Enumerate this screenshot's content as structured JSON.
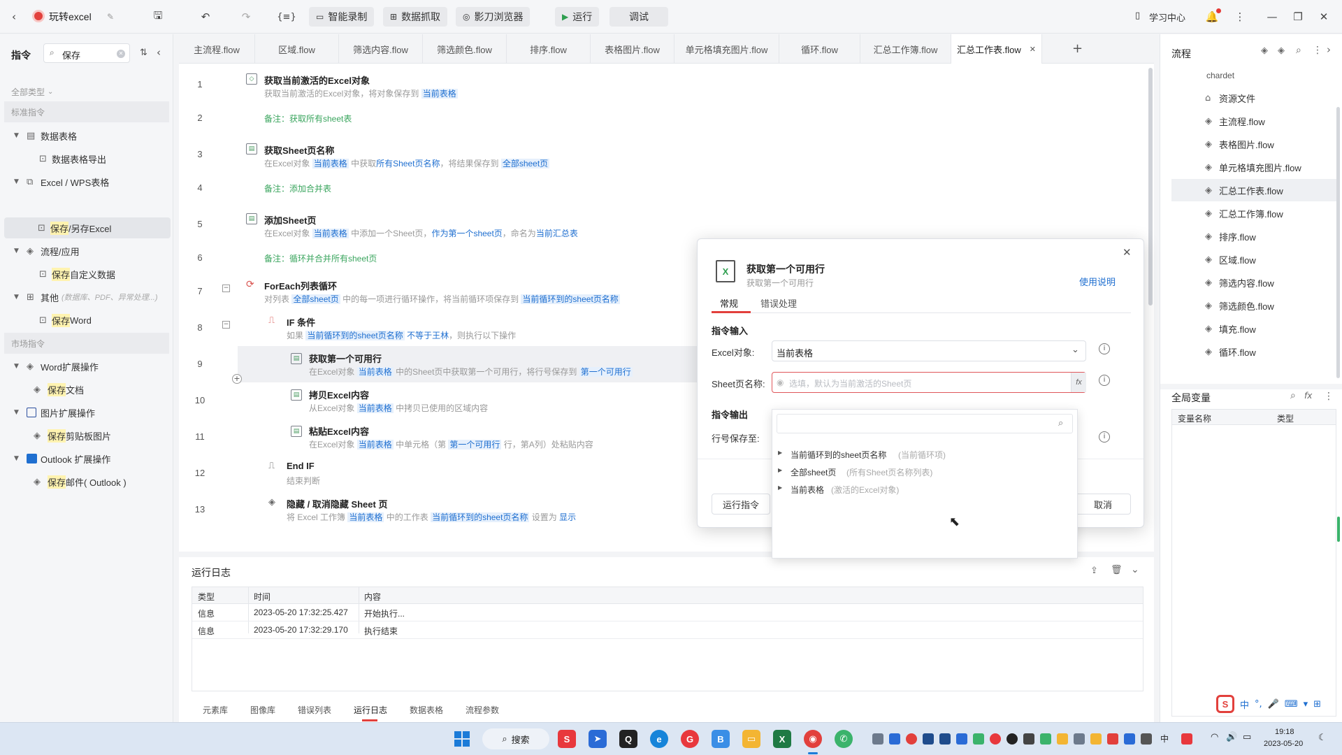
{
  "titlebar": {
    "app_name": "玩转excel",
    "buttons": {
      "smart_record": "智能录制",
      "data_capture": "数据抓取",
      "shadow_browser": "影刀浏览器",
      "run": "运行",
      "debug": "调试"
    },
    "learning_center": "学习中心"
  },
  "left": {
    "tab_title": "指令",
    "search_value": "保存",
    "all_types": "全部类型",
    "std_header": "标准指令",
    "groups": [
      {
        "label": "数据表格",
        "items": [
          {
            "label": "数据表格导出"
          }
        ]
      },
      {
        "label": "Excel / WPS表格",
        "items": [
          {
            "hl": "保存",
            "rest": "/另存Excel"
          }
        ]
      },
      {
        "label": "流程/应用",
        "items": [
          {
            "hl": "保存",
            "rest": "自定义数据"
          }
        ]
      },
      {
        "label": "其他",
        "note": "(数据库、PDF、异常处理...)",
        "items": [
          {
            "hl": "保存",
            "rest": "Word"
          }
        ]
      }
    ],
    "market_header": "市场指令",
    "market_groups": [
      {
        "label": "Word扩展操作",
        "items": [
          {
            "hl": "保存",
            "rest": "文档"
          }
        ]
      },
      {
        "label": "图片扩展操作",
        "items": [
          {
            "hl": "保存",
            "rest": "剪贴板图片"
          }
        ]
      },
      {
        "label": "Outlook 扩展操作",
        "items": [
          {
            "hl": "保存",
            "rest": "邮件( Outlook )"
          }
        ]
      }
    ]
  },
  "tabs": [
    "主流程.flow",
    "区域.flow",
    "筛选内容.flow",
    "筛选颜色.flow",
    "排序.flow",
    "表格图片.flow",
    "单元格填充图片.flow",
    "循环.flow",
    "汇总工作簿.flow",
    "汇总工作表.flow"
  ],
  "lines": {
    "l1": {
      "title": "获取当前激活的Excel对象",
      "d1": "获取当前激活的Excel对象，将对象保存到",
      "v1": "当前表格"
    },
    "l2": {
      "comment": "备注：获取所有sheet表"
    },
    "l3": {
      "title": "获取Sheet页名称",
      "d1": "在Excel对象",
      "v1": "当前表格",
      "d2": "中获取",
      "k1": "所有Sheet页名称",
      "d3": "，将结果保存到",
      "v2": "全部sheet页"
    },
    "l4": {
      "comment": "备注：添加合并表"
    },
    "l5": {
      "title": "添加Sheet页",
      "d1": "在Excel对象",
      "v1": "当前表格",
      "d2": "中添加一个Sheet页，",
      "k1": "作为第一个sheet页",
      "d3": "，命名为",
      "k2": "当前汇总表"
    },
    "l6": {
      "comment": "备注：循环并合并所有sheet页"
    },
    "l7": {
      "title": "ForEach列表循环",
      "d1": "对列表",
      "v1": "全部sheet页",
      "d2": "中的每一项进行循环操作，将当前循环项保存到",
      "v2": "当前循环到的sheet页名称"
    },
    "l8": {
      "title": "IF 条件",
      "d1": "如果",
      "v1": "当前循环到的sheet页名称",
      "k1": "不等于",
      "k2": "王林",
      "d2": "，则执行以下操作"
    },
    "l9": {
      "title": "获取第一个可用行",
      "d1": "在Excel对象",
      "v1": "当前表格",
      "d2": "中的Sheet页中获取第一个可用行，将行号保存到",
      "v2": "第一个可用行"
    },
    "l10": {
      "title": "拷贝Excel内容",
      "d1": "从Excel对象",
      "v1": "当前表格",
      "d2": "中拷贝已使用的区域内容"
    },
    "l11": {
      "title": "粘贴Excel内容",
      "d1": "在Excel对象",
      "v1": "当前表格",
      "d2": "中单元格（第",
      "v2": "第一个可用行",
      "d3": "行，第A列）处粘贴内容"
    },
    "l12": {
      "title": "End IF",
      "d1": "结束判断"
    },
    "l13": {
      "title": "隐藏 / 取消隐藏 Sheet 页",
      "d1": "将 Excel 工作簿",
      "v1": "当前表格",
      "d2": "中的工作表",
      "v2": "当前循环到的sheet页名称",
      "d3": "设置为",
      "k1": "显示"
    }
  },
  "log": {
    "title": "运行日志",
    "columns": [
      "类型",
      "时间",
      "内容"
    ],
    "rows": [
      {
        "type": "信息",
        "time": "2023-05-20 17:32:25.427",
        "content": "开始执行..."
      },
      {
        "type": "信息",
        "time": "2023-05-20 17:32:29.170",
        "content": "执行结束"
      }
    ],
    "bottom_tabs": [
      "元素库",
      "图像库",
      "错误列表",
      "运行日志",
      "数据表格",
      "流程参数"
    ]
  },
  "right": {
    "title": "流程",
    "root": "chardet",
    "items": [
      "资源文件",
      "主流程.flow",
      "表格图片.flow",
      "单元格填充图片.flow",
      "汇总工作表.flow",
      "汇总工作簿.flow",
      "排序.flow",
      "区域.flow",
      "筛选内容.flow",
      "筛选颜色.flow",
      "填充.flow",
      "循环.flow"
    ],
    "vars_title": "全局变量",
    "vars_cols": [
      "变量名称",
      "类型"
    ]
  },
  "dialog": {
    "title": "获取第一个可用行",
    "subtitle": "获取第一个可用行",
    "help": "使用说明",
    "tab_general": "常规",
    "tab_error": "错误处理",
    "input_section": "指令输入",
    "excel_label": "Excel对象:",
    "excel_value": "当前表格",
    "sheet_label": "Sheet页名称:",
    "sheet_placeholder": "选填，默认为当前激活的Sheet页",
    "output_section": "指令输出",
    "row_label": "行号保存至:",
    "run_button": "运行指令",
    "cancel_button": "取消"
  },
  "dropdown": {
    "options": [
      {
        "name": "当前循环到的sheet页名称",
        "hint": "(当前循环项)"
      },
      {
        "name": "全部sheet页",
        "hint": "(所有Sheet页名称列表)"
      },
      {
        "name": "当前表格",
        "hint": "(激活的Excel对象)"
      }
    ]
  },
  "taskbar": {
    "search": "搜索",
    "ime": "中",
    "time": "19:18",
    "date": "2023-05-20"
  },
  "colors": {
    "accent": "#1f6fd0",
    "comment": "#3aa55e",
    "error_border": "#e0575b",
    "highlight": "#fff3b0"
  }
}
